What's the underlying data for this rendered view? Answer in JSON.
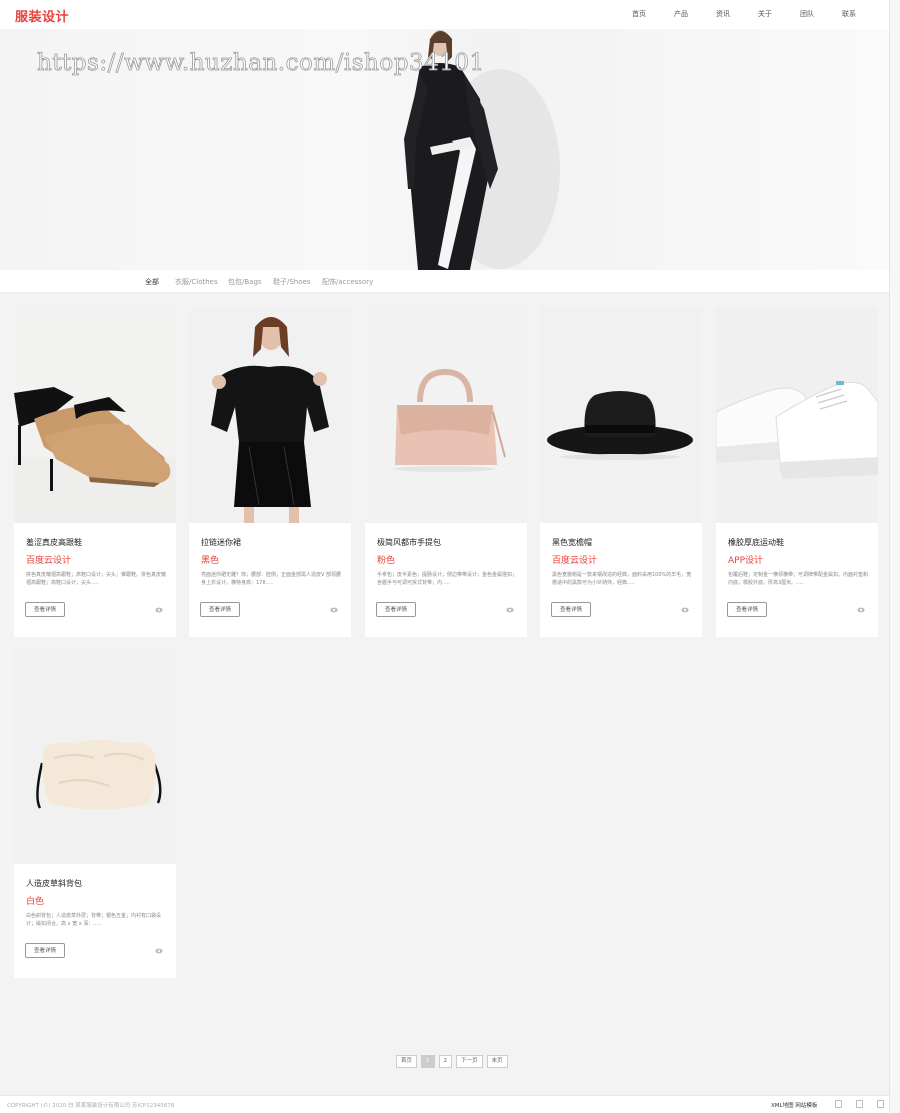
{
  "header": {
    "logo": "服装设计",
    "nav": [
      "首页",
      "产品",
      "资讯",
      "关于",
      "团队",
      "联系"
    ]
  },
  "banner": {
    "watermark": "https://www.huzhan.com/ishop34101"
  },
  "categories": [
    "全部",
    "衣服/Clothes",
    "包包/Bags",
    "鞋子/Shoes",
    "配饰/accessory"
  ],
  "products": [
    {
      "title": "羞涩真皮高跟鞋",
      "sub": "百度云设计",
      "desc": "拼色真皮皱褶高跟鞋；高鞋口设计；尖头；锥跟鞋。拼色真皮皱褶高跟鞋；高鞋口设计；尖头.....",
      "button": "查看详情"
    },
    {
      "title": "拉链迷你裙",
      "sub": "黑色",
      "desc": "亮面迷你裙无雕？饰；腰部：腔侧；正面金部需人造皮V 部领腰身上衣设计。横特身高：178.....",
      "button": "查看详情"
    },
    {
      "title": "极简风都市手提包",
      "sub": "粉色",
      "desc": "手拿包；皮半素色；提肠设计；侧边带带设计；金色金属搭扣；含握手与可调可拆式背带；内.....",
      "button": "查看详情"
    },
    {
      "title": "黑色宽檐帽",
      "sub": "百度云设计",
      "desc": "黑色宽檐帽是一款来钢改造的经典，面料采用100%的羊毛，宽檐适中的黑款可为小伙骑帅，经典.....",
      "button": "查看详情"
    },
    {
      "title": "橡胶厚底运动鞋",
      "sub": "APP设计",
      "desc": "包覆后鞋；定制金一横领横带；可调牌带配金属扣。内面衬垫和内底，橡胶外底。厚高3厘米。.....",
      "button": "查看详情"
    },
    {
      "title": "人造皮草斜背包",
      "sub": "白色",
      "desc": "白色斜背包；人造皮草外层；背带；银色五金；内衬有口袋设计；磁扣闭合。高 x 宽 x 深：.....",
      "button": "查看详情"
    }
  ],
  "pagination": [
    "首页",
    "1",
    "2",
    "下一页",
    "末页"
  ],
  "footer": {
    "copyright": "COPYRIGHT (©) 2020 白 某某服装设计有限公司 苏ICP12345678",
    "links": "XML地图 网站模板"
  },
  "colors": {
    "accent": "#e8423c",
    "background": "#f3f3f3"
  }
}
